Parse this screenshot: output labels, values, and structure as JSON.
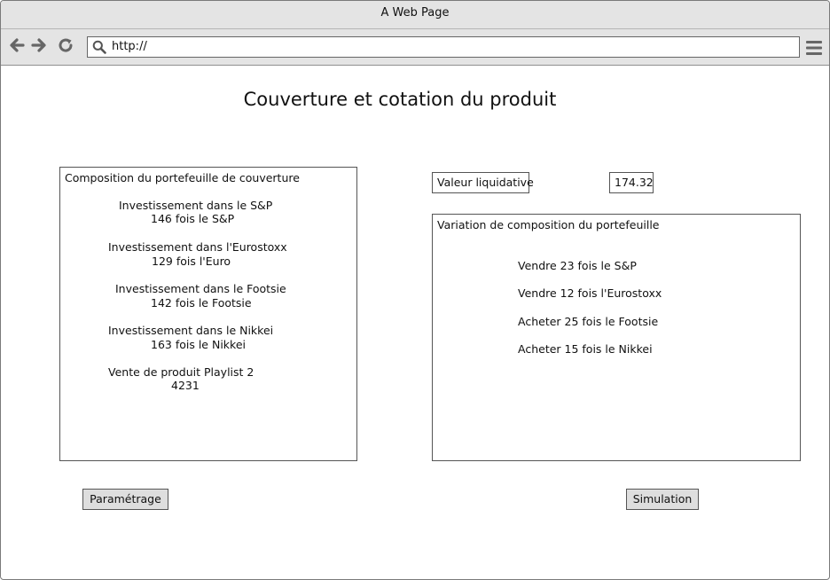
{
  "window": {
    "title": "A Web Page"
  },
  "browser": {
    "url": "http://"
  },
  "page": {
    "title": "Couverture et cotation du produit"
  },
  "composition": {
    "heading": "Composition du portefeuille de couverture",
    "items": [
      {
        "label": "Investissement dans le S&P",
        "value": "146 fois le S&P"
      },
      {
        "label": "Investissement dans l'Eurostoxx",
        "value": "129 fois l'Euro"
      },
      {
        "label": "Investissement dans le Footsie",
        "value": "142 fois le Footsie"
      },
      {
        "label": "Investissement dans le Nikkei",
        "value": "163 fois le Nikkei"
      },
      {
        "label": "Vente de produit Playlist 2",
        "value": "4231"
      }
    ]
  },
  "valuation": {
    "label": "Valeur liquidative",
    "value": "174.32"
  },
  "variation": {
    "heading": "Variation de composition du portefeuille",
    "items": [
      "Vendre 23 fois le S&P",
      "Vendre 12 fois l'Eurostoxx",
      "Acheter 25 fois le Footsie",
      "Acheter 15 fois le Nikkei"
    ]
  },
  "buttons": {
    "settings": "Paramétrage",
    "simulation": "Simulation"
  },
  "icons": [
    "back-arrow-icon",
    "forward-arrow-icon",
    "reload-icon",
    "search-icon",
    "hamburger-menu-icon"
  ]
}
